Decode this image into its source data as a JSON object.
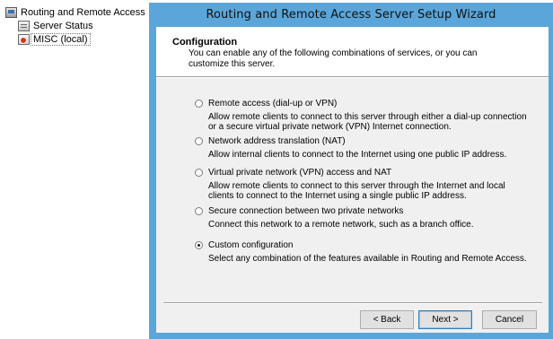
{
  "tree": {
    "root": {
      "label": "Routing and Remote Access",
      "icon": "routing-remote-access-icon"
    },
    "children": [
      {
        "label": "Server Status",
        "icon": "server-status-icon"
      },
      {
        "label": "MISC (local)",
        "icon": "server-icon"
      }
    ]
  },
  "wizard": {
    "title": "Routing and Remote Access Server Setup Wizard",
    "header": {
      "title": "Configuration",
      "subtitle": "You can enable any of the following combinations of services, or you can customize this server."
    },
    "options": [
      {
        "label": "Remote access (dial-up or VPN)",
        "description": "Allow remote clients to connect to this server through either a dial-up connection or a secure virtual private network (VPN) Internet connection.",
        "selected": false
      },
      {
        "label": "Network address translation (NAT)",
        "description": "Allow internal clients to connect to the Internet using one public IP address.",
        "selected": false
      },
      {
        "label": "Virtual private network (VPN) access and NAT",
        "description": "Allow remote clients to connect to this server through the Internet and local clients to connect to the Internet using a single public IP address.",
        "selected": false
      },
      {
        "label": "Secure connection between two private networks",
        "description": "Connect this network to a remote network, such as a branch office.",
        "selected": false
      },
      {
        "label": "Custom configuration",
        "description": "Select any combination of the features available in Routing and Remote Access.",
        "selected": true
      }
    ],
    "buttons": {
      "back": "< Back",
      "next": "Next >",
      "cancel": "Cancel"
    }
  },
  "colors": {
    "title_bar": "#5aa6da",
    "client_bg": "#f0f0f0",
    "header_bg": "#ffffff"
  }
}
